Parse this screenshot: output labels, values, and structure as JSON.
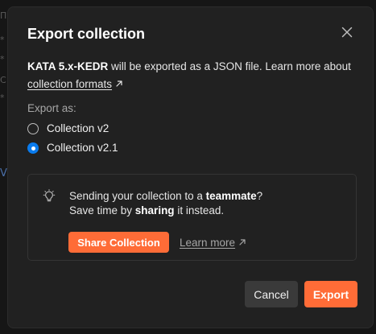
{
  "dialog": {
    "title": "Export collection",
    "description": {
      "collection_name": "KATA 5.x-KEDR",
      "text": " will be exported as a JSON file. Learn more about ",
      "link_label": "collection formats"
    },
    "export_as_label": "Export as:",
    "options": [
      {
        "label": "Collection v2",
        "checked": false
      },
      {
        "label": "Collection v2.1",
        "checked": true
      }
    ],
    "tip": {
      "line1_prefix": "Sending your collection to a ",
      "line1_bold": "teammate",
      "line1_suffix": "?",
      "line2_prefix": "Save time by ",
      "line2_bold": "sharing",
      "line2_suffix": " it instead.",
      "share_button": "Share Collection",
      "learn_more": "Learn more"
    },
    "buttons": {
      "cancel": "Cancel",
      "export": "Export"
    }
  },
  "colors": {
    "accent": "#ff6c37",
    "radio_selected": "#097bed",
    "dialog_bg": "#212121"
  },
  "icons": {
    "close": "close-icon",
    "external": "external-link-arrow-icon",
    "tip": "lightbulb-icon"
  }
}
